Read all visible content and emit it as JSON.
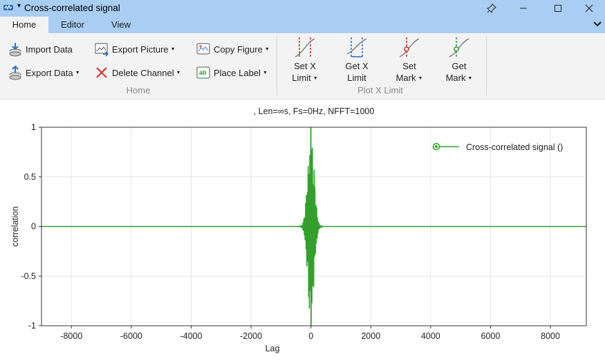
{
  "window": {
    "title": "Cross-correlated signal",
    "icons": [
      "app-icon",
      "pin-icon",
      "minimize-icon",
      "maximize-icon",
      "close-icon"
    ]
  },
  "tabs": [
    {
      "label": "Home",
      "active": true
    },
    {
      "label": "Editor",
      "active": false
    },
    {
      "label": "View",
      "active": false
    }
  ],
  "ribbon": {
    "home_group": {
      "label": "Home",
      "import_data": "Import Data",
      "export_data": "Export Data",
      "export_picture": "Export Picture",
      "delete_channel": "Delete Channel",
      "copy_figure": "Copy Figure",
      "place_label": "Place Label"
    },
    "plot_x_limit_group": {
      "label": "Plot X Limit",
      "set_x_limit": [
        "Set X",
        "Limit"
      ],
      "get_x_limit": [
        "Get X",
        "Limit"
      ],
      "set_mark": [
        "Set",
        "Mark"
      ],
      "get_mark": [
        "Get",
        "Mark"
      ]
    }
  },
  "chart_data": {
    "type": "line",
    "title": ", Len=∞s, Fs=0Hz, NFFT=1000",
    "xlabel": "Lag",
    "ylabel": "correlation",
    "xlim": [
      -9000,
      9200
    ],
    "ylim": [
      -1,
      1
    ],
    "xticks": [
      -8000,
      -6000,
      -4000,
      -2000,
      0,
      2000,
      4000,
      6000,
      8000
    ],
    "yticks": [
      1,
      0.5,
      0,
      -0.5,
      -1
    ],
    "ytick_labels": [
      "1",
      "0.5",
      "0",
      "-0.5",
      "-1"
    ],
    "grid": true,
    "legend_position": "top-right",
    "series": [
      {
        "name": "Cross-correlated signal ()",
        "color": "#33a02c",
        "description_points": [
          {
            "x": -9000,
            "y": 0
          },
          {
            "x": -400,
            "y": 0
          },
          {
            "x": -300,
            "y": 0.05
          },
          {
            "x": -200,
            "y": -0.25
          },
          {
            "x": -150,
            "y": 0.4
          },
          {
            "x": -100,
            "y": -0.55
          },
          {
            "x": -60,
            "y": 0.8
          },
          {
            "x": -30,
            "y": -0.9
          },
          {
            "x": 0,
            "y": 1.0
          },
          {
            "x": 20,
            "y": -1.0
          },
          {
            "x": 60,
            "y": 0.85
          },
          {
            "x": 100,
            "y": -0.7
          },
          {
            "x": 150,
            "y": 0.45
          },
          {
            "x": 200,
            "y": -0.3
          },
          {
            "x": 300,
            "y": 0.08
          },
          {
            "x": 400,
            "y": 0
          },
          {
            "x": 9200,
            "y": 0
          }
        ]
      }
    ]
  }
}
